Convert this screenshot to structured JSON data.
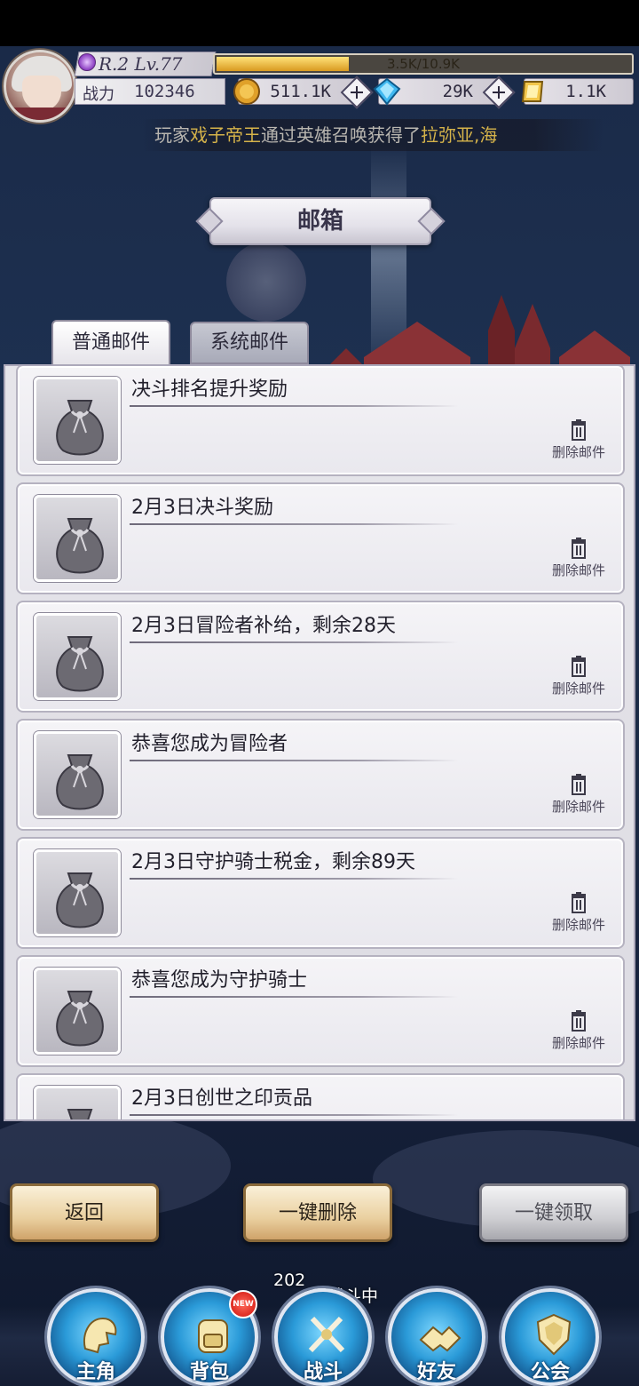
{
  "player": {
    "rank_level": "R.2 Lv.77",
    "exp_text": "3.5K/10.9K",
    "exp_progress": 0.32,
    "power_label": "战力",
    "power_value": "102346"
  },
  "resources": [
    {
      "name": "gold",
      "value": "511.1K",
      "icon": "gold-coin-icon"
    },
    {
      "name": "diamond",
      "value": "29K",
      "icon": "blue-diamond-icon"
    },
    {
      "name": "ticket",
      "value": "1.1K",
      "icon": "gold-ticket-icon"
    }
  ],
  "marquee": {
    "prefix": "玩家",
    "player_name": "戏子帝王",
    "middle": "通过英雄召唤获得了",
    "hero_name": "拉弥亚,海"
  },
  "mailbox": {
    "title": "邮箱",
    "tabs": [
      {
        "label": "普通邮件",
        "active": true
      },
      {
        "label": "系统邮件",
        "active": false
      }
    ],
    "delete_label": "删除邮件",
    "items": [
      {
        "title": "决斗排名提升奖励"
      },
      {
        "title": "2月3日决斗奖励"
      },
      {
        "title": "2月3日冒险者补给，剩余28天"
      },
      {
        "title": "恭喜您成为冒险者"
      },
      {
        "title": "2月3日守护骑士税金，剩余89天"
      },
      {
        "title": "恭喜您成为守护骑士"
      },
      {
        "title": "2月3日创世之印贡品"
      }
    ]
  },
  "actions": {
    "back": "返回",
    "delete_all": "一键删除",
    "claim_all": "一键领取"
  },
  "battle_progress": {
    "floor": "202",
    "status": "层战斗中"
  },
  "nav": {
    "new_badge": "NEW",
    "items": [
      {
        "label": "主角",
        "icon": "hero-helmet-icon"
      },
      {
        "label": "背包",
        "icon": "backpack-icon"
      },
      {
        "label": "战斗",
        "icon": "crossed-swords-icon"
      },
      {
        "label": "好友",
        "icon": "handshake-icon"
      },
      {
        "label": "公会",
        "icon": "guild-crest-icon"
      }
    ]
  },
  "colors": {
    "accent_gold": "#d5b34a",
    "nav_blue": "#2a9ad8",
    "panel_bg": "#e6e5ea"
  }
}
